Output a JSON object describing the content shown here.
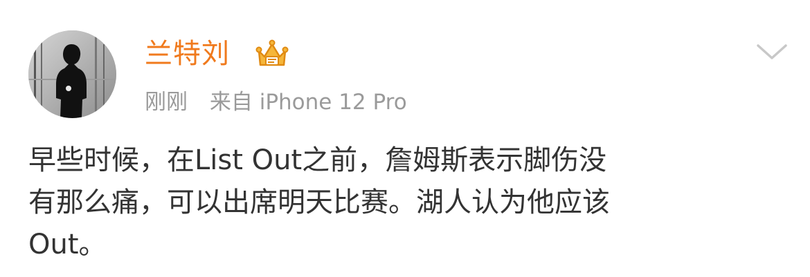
{
  "post": {
    "user": {
      "name": "兰特刘",
      "avatar_icon": "user-avatar-silhouette",
      "badge_icon": "vip-crown-badge-icon"
    },
    "meta": {
      "time": "刚刚",
      "source": "来自 iPhone 12 Pro"
    },
    "menu_icon": "chevron-down-icon",
    "content": "早些时候，在List Out之前，詹姆斯表示脚伤没\n有那么痛，可以出席明天比赛。湖人认为他应该\nOut。"
  },
  "colors": {
    "username": "#f07a1d",
    "meta": "#9a9a9a",
    "content": "#333333",
    "background": "#ffffff",
    "chevron": "#c8c8c8"
  }
}
